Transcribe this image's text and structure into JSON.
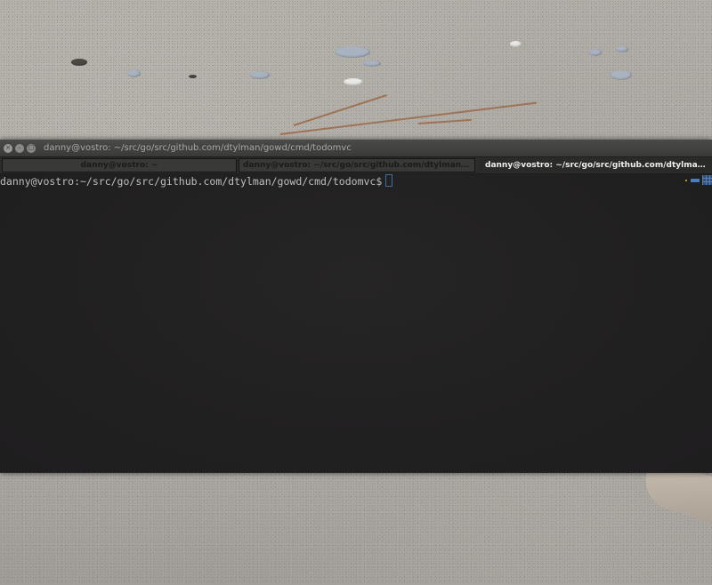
{
  "window": {
    "title": "danny@vostro: ~/src/go/src/github.com/dtylman/gowd/cmd/todomvc"
  },
  "tabs": [
    {
      "label": "danny@vostro: ~"
    },
    {
      "label": "danny@vostro: ~/src/go/src/github.com/dtylman/gow..."
    },
    {
      "label": "danny@vostro: ~/src/go/src/github.com/dtylman/gow..."
    }
  ],
  "terminal": {
    "prompt": "danny@vostro:~/src/go/src/github.com/dtylman/gowd/cmd/todomvc$"
  },
  "icons": {
    "close": "close-icon",
    "minimize": "minimize-icon",
    "maximize": "maximize-icon"
  },
  "colors": {
    "terminal_bg": "#212021",
    "prompt_text": "#bfbfbf",
    "cursor": "#3a6ea5",
    "active_tab_text": "#f0f0f0"
  }
}
